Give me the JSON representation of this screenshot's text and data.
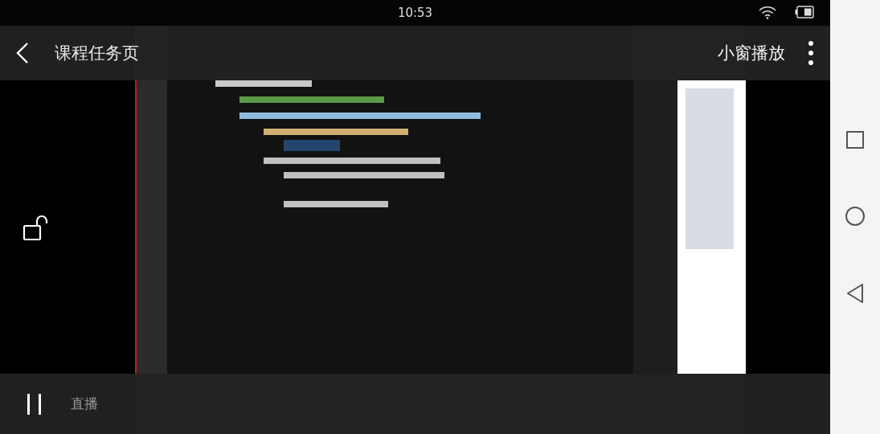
{
  "status_bar": {
    "time": "10:53"
  },
  "top_bar": {
    "title": "课程任务页",
    "action": "小窗播放"
  },
  "bottom_bar": {
    "playing": true,
    "label": "直播"
  }
}
